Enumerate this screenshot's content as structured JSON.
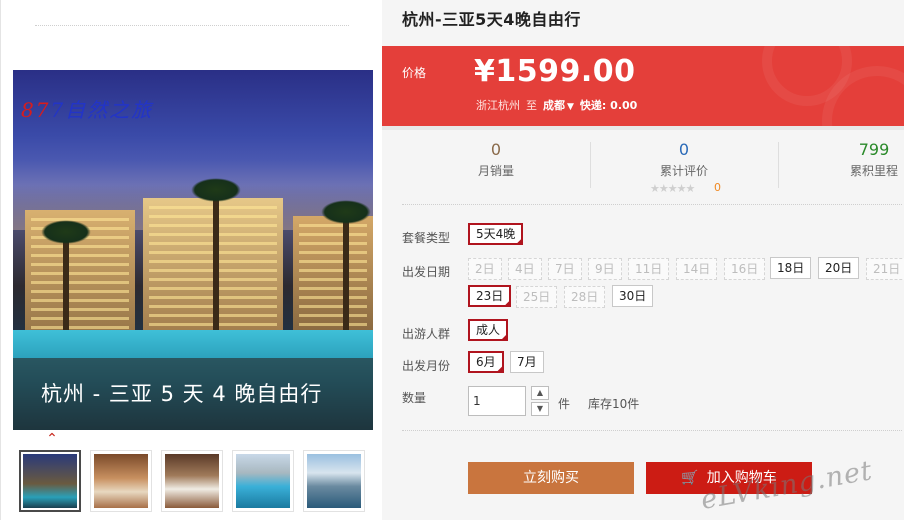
{
  "gallery": {
    "photo_logo": "7自然之旅",
    "photo_logo_num": "87",
    "caption": "杭州 - 三亚 5 天 4 晚自由行",
    "thumb_count": 5
  },
  "product": {
    "title": "杭州-三亚5天4晚自由行"
  },
  "price": {
    "label": "价格",
    "value": "¥1599.00",
    "origin": "浙江杭州",
    "to_word": "至",
    "destination": "成都",
    "shipping_label": "快递:",
    "shipping_fee": "0.00"
  },
  "stats": {
    "monthly_sales": {
      "value": "0",
      "label": "月销量",
      "color": "#8a6a4a"
    },
    "reviews": {
      "value": "0",
      "label": "累计评价",
      "color": "#2a6ab8",
      "stars": "★★★★★",
      "star_count": "0"
    },
    "points": {
      "value": "799",
      "label": "累积里程",
      "color": "#2a8a2a"
    }
  },
  "options": {
    "package": {
      "label": "套餐类型",
      "items": [
        {
          "text": "5天4晚",
          "state": "selected"
        }
      ]
    },
    "departure_date": {
      "label": "出发日期",
      "items": [
        {
          "text": "2日",
          "state": "disabled"
        },
        {
          "text": "4日",
          "state": "disabled"
        },
        {
          "text": "7日",
          "state": "disabled"
        },
        {
          "text": "9日",
          "state": "disabled"
        },
        {
          "text": "11日",
          "state": "disabled"
        },
        {
          "text": "14日",
          "state": "disabled"
        },
        {
          "text": "16日",
          "state": "disabled"
        },
        {
          "text": "18日",
          "state": "normal"
        },
        {
          "text": "20日",
          "state": "normal"
        },
        {
          "text": "21日",
          "state": "disabled"
        },
        {
          "text": "23日",
          "state": "selected"
        },
        {
          "text": "25日",
          "state": "disabled"
        },
        {
          "text": "28日",
          "state": "disabled"
        },
        {
          "text": "30日",
          "state": "normal"
        }
      ]
    },
    "travelers": {
      "label": "出游人群",
      "items": [
        {
          "text": "成人",
          "state": "selected"
        }
      ]
    },
    "departure_month": {
      "label": "出发月份",
      "items": [
        {
          "text": "6月",
          "state": "selected"
        },
        {
          "text": "7月",
          "state": "normal"
        }
      ]
    }
  },
  "quantity": {
    "label": "数量",
    "value": "1",
    "unit": "件",
    "stock": "库存10件"
  },
  "buttons": {
    "buy_now": "立刻购买",
    "add_to_cart": "加入购物车"
  },
  "watermark": "eLVking.net",
  "colors": {
    "price_panel": "#e43f3a",
    "buy_button": "#c9753e",
    "cart_button": "#cc1c14",
    "selected_border": "#b0141e"
  }
}
